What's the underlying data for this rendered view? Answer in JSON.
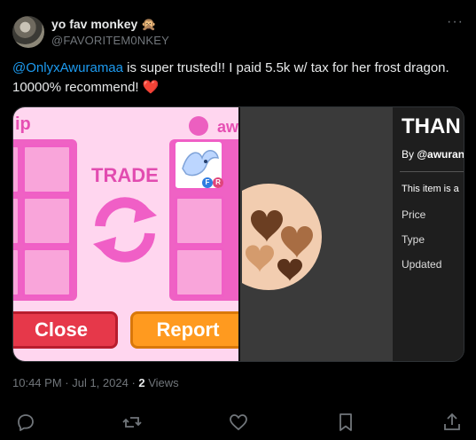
{
  "author": {
    "display_name": "yo fav monkey 🙊",
    "handle": "@FAVORITEM0NKEY"
  },
  "tweet": {
    "mention": "@OnlyxAwuramaa",
    "text": " is super trusted!! I paid 5.5k w/ tax for her frost dragon. 10000% recommend! ",
    "emoji": "❤️"
  },
  "media": {
    "left": {
      "label_left": "ip",
      "label_right": "aw",
      "trade_label": "TRADE",
      "close_label": "Close",
      "report_label": "Report",
      "badges": [
        "F",
        "R"
      ]
    },
    "right": {
      "title": "THAN",
      "by_prefix": "By ",
      "by_user": "@awuran",
      "item_line": "This item is a",
      "props": [
        "Price",
        "Type",
        "Updated"
      ]
    }
  },
  "meta": {
    "time": "10:44 PM",
    "date": "Jul 1, 2024",
    "views_count": "2",
    "views_label": " Views"
  },
  "actions": [
    "reply-icon",
    "retweet-icon",
    "like-icon",
    "bookmark-icon",
    "share-icon"
  ],
  "colors": {
    "accent": "#1d9bf0",
    "muted": "#71767b",
    "text": "#e7e9ea"
  }
}
